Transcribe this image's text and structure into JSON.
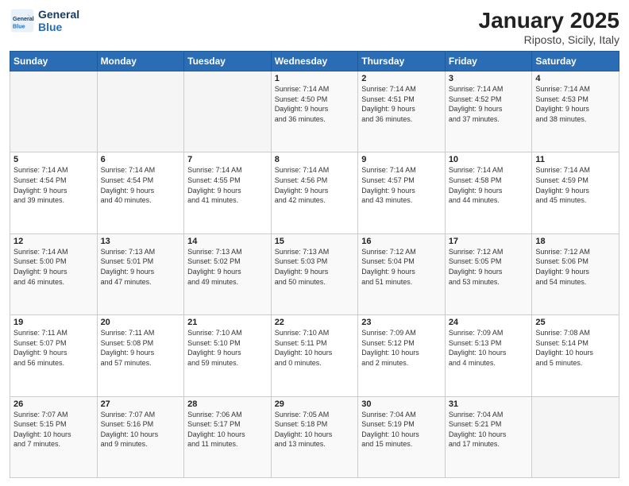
{
  "header": {
    "logo_line1": "General",
    "logo_line2": "Blue",
    "title": "January 2025",
    "subtitle": "Riposto, Sicily, Italy"
  },
  "weekdays": [
    "Sunday",
    "Monday",
    "Tuesday",
    "Wednesday",
    "Thursday",
    "Friday",
    "Saturday"
  ],
  "weeks": [
    [
      {
        "day": "",
        "info": ""
      },
      {
        "day": "",
        "info": ""
      },
      {
        "day": "",
        "info": ""
      },
      {
        "day": "1",
        "info": "Sunrise: 7:14 AM\nSunset: 4:50 PM\nDaylight: 9 hours\nand 36 minutes."
      },
      {
        "day": "2",
        "info": "Sunrise: 7:14 AM\nSunset: 4:51 PM\nDaylight: 9 hours\nand 36 minutes."
      },
      {
        "day": "3",
        "info": "Sunrise: 7:14 AM\nSunset: 4:52 PM\nDaylight: 9 hours\nand 37 minutes."
      },
      {
        "day": "4",
        "info": "Sunrise: 7:14 AM\nSunset: 4:53 PM\nDaylight: 9 hours\nand 38 minutes."
      }
    ],
    [
      {
        "day": "5",
        "info": "Sunrise: 7:14 AM\nSunset: 4:54 PM\nDaylight: 9 hours\nand 39 minutes."
      },
      {
        "day": "6",
        "info": "Sunrise: 7:14 AM\nSunset: 4:54 PM\nDaylight: 9 hours\nand 40 minutes."
      },
      {
        "day": "7",
        "info": "Sunrise: 7:14 AM\nSunset: 4:55 PM\nDaylight: 9 hours\nand 41 minutes."
      },
      {
        "day": "8",
        "info": "Sunrise: 7:14 AM\nSunset: 4:56 PM\nDaylight: 9 hours\nand 42 minutes."
      },
      {
        "day": "9",
        "info": "Sunrise: 7:14 AM\nSunset: 4:57 PM\nDaylight: 9 hours\nand 43 minutes."
      },
      {
        "day": "10",
        "info": "Sunrise: 7:14 AM\nSunset: 4:58 PM\nDaylight: 9 hours\nand 44 minutes."
      },
      {
        "day": "11",
        "info": "Sunrise: 7:14 AM\nSunset: 4:59 PM\nDaylight: 9 hours\nand 45 minutes."
      }
    ],
    [
      {
        "day": "12",
        "info": "Sunrise: 7:14 AM\nSunset: 5:00 PM\nDaylight: 9 hours\nand 46 minutes."
      },
      {
        "day": "13",
        "info": "Sunrise: 7:13 AM\nSunset: 5:01 PM\nDaylight: 9 hours\nand 47 minutes."
      },
      {
        "day": "14",
        "info": "Sunrise: 7:13 AM\nSunset: 5:02 PM\nDaylight: 9 hours\nand 49 minutes."
      },
      {
        "day": "15",
        "info": "Sunrise: 7:13 AM\nSunset: 5:03 PM\nDaylight: 9 hours\nand 50 minutes."
      },
      {
        "day": "16",
        "info": "Sunrise: 7:12 AM\nSunset: 5:04 PM\nDaylight: 9 hours\nand 51 minutes."
      },
      {
        "day": "17",
        "info": "Sunrise: 7:12 AM\nSunset: 5:05 PM\nDaylight: 9 hours\nand 53 minutes."
      },
      {
        "day": "18",
        "info": "Sunrise: 7:12 AM\nSunset: 5:06 PM\nDaylight: 9 hours\nand 54 minutes."
      }
    ],
    [
      {
        "day": "19",
        "info": "Sunrise: 7:11 AM\nSunset: 5:07 PM\nDaylight: 9 hours\nand 56 minutes."
      },
      {
        "day": "20",
        "info": "Sunrise: 7:11 AM\nSunset: 5:08 PM\nDaylight: 9 hours\nand 57 minutes."
      },
      {
        "day": "21",
        "info": "Sunrise: 7:10 AM\nSunset: 5:10 PM\nDaylight: 9 hours\nand 59 minutes."
      },
      {
        "day": "22",
        "info": "Sunrise: 7:10 AM\nSunset: 5:11 PM\nDaylight: 10 hours\nand 0 minutes."
      },
      {
        "day": "23",
        "info": "Sunrise: 7:09 AM\nSunset: 5:12 PM\nDaylight: 10 hours\nand 2 minutes."
      },
      {
        "day": "24",
        "info": "Sunrise: 7:09 AM\nSunset: 5:13 PM\nDaylight: 10 hours\nand 4 minutes."
      },
      {
        "day": "25",
        "info": "Sunrise: 7:08 AM\nSunset: 5:14 PM\nDaylight: 10 hours\nand 5 minutes."
      }
    ],
    [
      {
        "day": "26",
        "info": "Sunrise: 7:07 AM\nSunset: 5:15 PM\nDaylight: 10 hours\nand 7 minutes."
      },
      {
        "day": "27",
        "info": "Sunrise: 7:07 AM\nSunset: 5:16 PM\nDaylight: 10 hours\nand 9 minutes."
      },
      {
        "day": "28",
        "info": "Sunrise: 7:06 AM\nSunset: 5:17 PM\nDaylight: 10 hours\nand 11 minutes."
      },
      {
        "day": "29",
        "info": "Sunrise: 7:05 AM\nSunset: 5:18 PM\nDaylight: 10 hours\nand 13 minutes."
      },
      {
        "day": "30",
        "info": "Sunrise: 7:04 AM\nSunset: 5:19 PM\nDaylight: 10 hours\nand 15 minutes."
      },
      {
        "day": "31",
        "info": "Sunrise: 7:04 AM\nSunset: 5:21 PM\nDaylight: 10 hours\nand 17 minutes."
      },
      {
        "day": "",
        "info": ""
      }
    ]
  ]
}
